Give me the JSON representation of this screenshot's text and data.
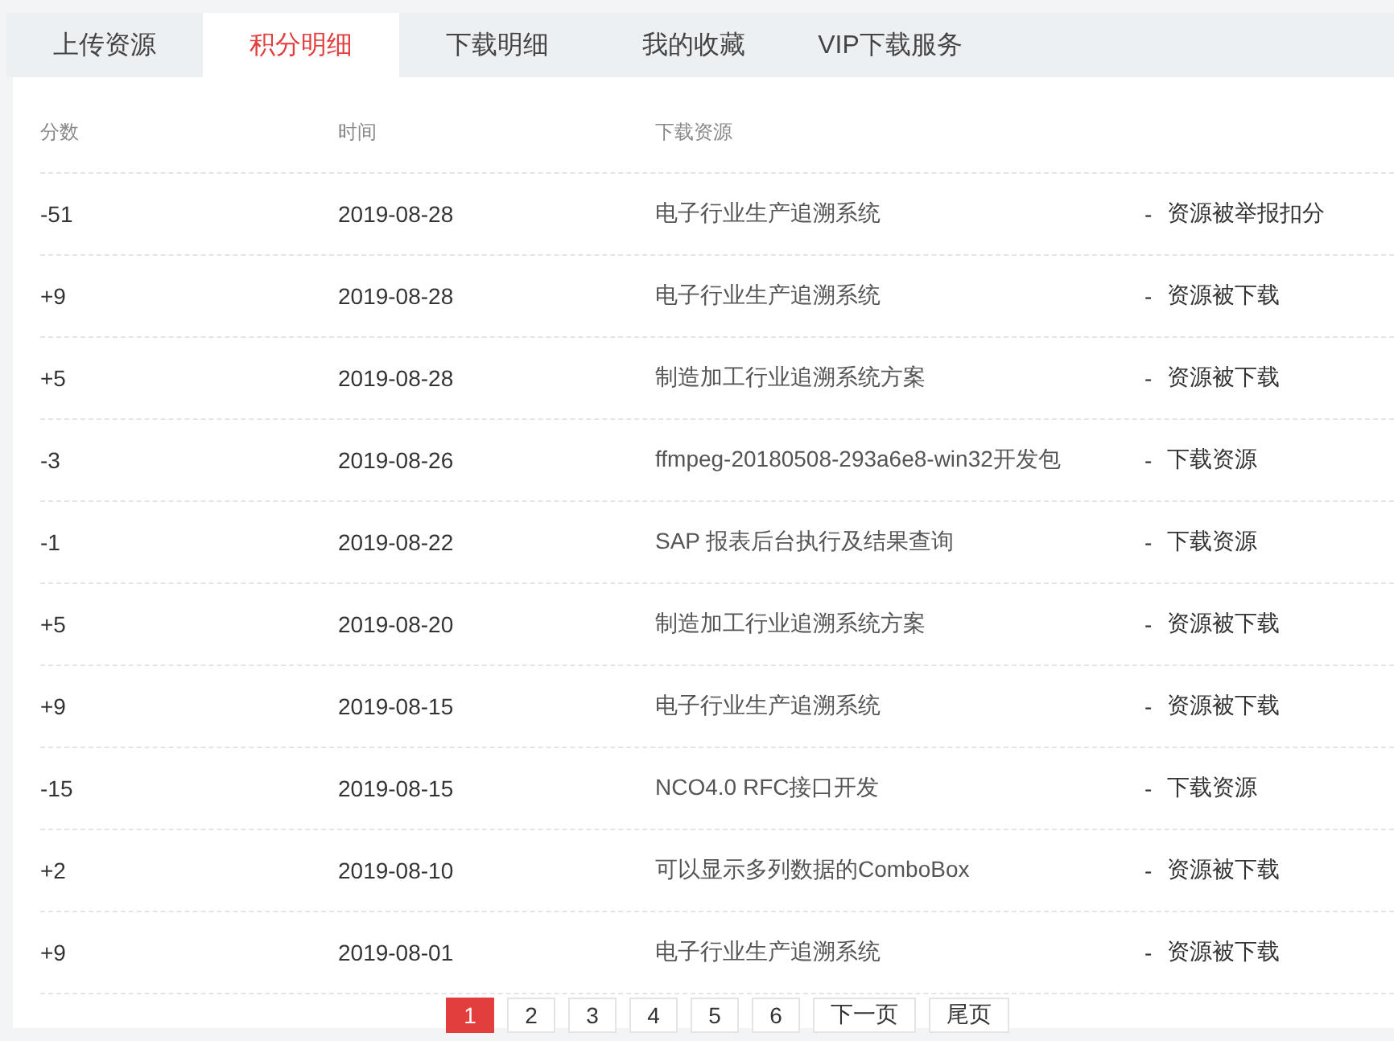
{
  "tabs": [
    {
      "label": "上传资源",
      "selected": false
    },
    {
      "label": "积分明细",
      "selected": true
    },
    {
      "label": "下载明细",
      "selected": false
    },
    {
      "label": "我的收藏",
      "selected": false
    },
    {
      "label": "VIP下载服务",
      "selected": false
    }
  ],
  "table": {
    "columns": [
      "分数",
      "时间",
      "下载资源"
    ],
    "rows": [
      {
        "score": "-51",
        "time": "2019-08-28",
        "resource": "电子行业生产追溯系统",
        "dash": "-",
        "reason": "资源被举报扣分"
      },
      {
        "score": "+9",
        "time": "2019-08-28",
        "resource": "电子行业生产追溯系统",
        "dash": "-",
        "reason": "资源被下载"
      },
      {
        "score": "+5",
        "time": "2019-08-28",
        "resource": "制造加工行业追溯系统方案",
        "dash": "-",
        "reason": "资源被下载"
      },
      {
        "score": "-3",
        "time": "2019-08-26",
        "resource": "ffmpeg-20180508-293a6e8-win32开发包",
        "dash": "-",
        "reason": "下载资源"
      },
      {
        "score": "-1",
        "time": "2019-08-22",
        "resource": "SAP 报表后台执行及结果查询",
        "dash": "-",
        "reason": "下载资源"
      },
      {
        "score": "+5",
        "time": "2019-08-20",
        "resource": "制造加工行业追溯系统方案",
        "dash": "-",
        "reason": "资源被下载"
      },
      {
        "score": "+9",
        "time": "2019-08-15",
        "resource": "电子行业生产追溯系统",
        "dash": "-",
        "reason": "资源被下载"
      },
      {
        "score": "-15",
        "time": "2019-08-15",
        "resource": "NCO4.0 RFC接口开发",
        "dash": "-",
        "reason": "下载资源"
      },
      {
        "score": "+2",
        "time": "2019-08-10",
        "resource": "可以显示多列数据的ComboBox",
        "dash": "-",
        "reason": "资源被下载"
      },
      {
        "score": "+9",
        "time": "2019-08-01",
        "resource": "电子行业生产追溯系统",
        "dash": "-",
        "reason": "资源被下载"
      }
    ]
  },
  "pagination": [
    {
      "label": "1",
      "selected": true
    },
    {
      "label": "2",
      "selected": false
    },
    {
      "label": "3",
      "selected": false
    },
    {
      "label": "4",
      "selected": false
    },
    {
      "label": "5",
      "selected": false
    },
    {
      "label": "6",
      "selected": false
    },
    {
      "label": "下一页",
      "selected": false
    },
    {
      "label": "尾页",
      "selected": false
    }
  ]
}
